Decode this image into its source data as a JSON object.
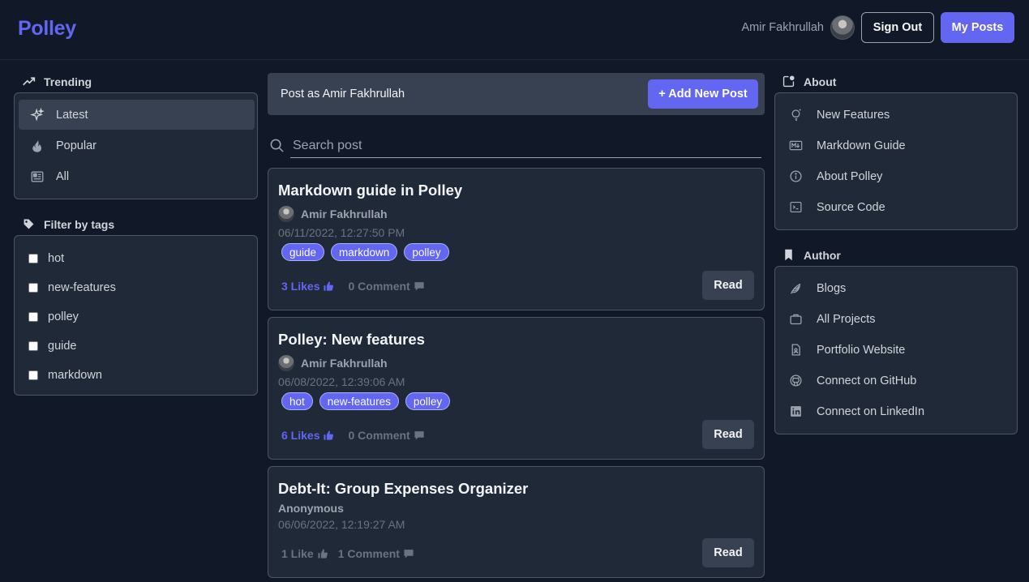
{
  "header": {
    "logo": "Polley",
    "user_name": "Amir Fakhrullah",
    "sign_out": "Sign Out",
    "my_posts": "My Posts"
  },
  "left": {
    "trending_title": "Trending",
    "trending_items": [
      {
        "label": "Latest",
        "icon": "sparkles-icon",
        "active": true
      },
      {
        "label": "Popular",
        "icon": "fire-icon"
      },
      {
        "label": "All",
        "icon": "newspaper-icon"
      }
    ],
    "filter_title": "Filter by tags",
    "tags": [
      "hot",
      "new-features",
      "polley",
      "guide",
      "markdown"
    ]
  },
  "main": {
    "post_as": "Post as Amir Fakhrullah",
    "add_post": "+ Add New Post",
    "search_placeholder": "Search post",
    "read_label": "Read",
    "posts": [
      {
        "title": "Markdown guide in Polley",
        "author": "Amir Fakhrullah",
        "date": "06/11/2022, 12:27:50 PM",
        "tags": [
          "guide",
          "markdown",
          "polley"
        ],
        "likes": "3 Likes",
        "comments": "0 Comment"
      },
      {
        "title": "Polley: New features",
        "author": "Amir Fakhrullah",
        "date": "06/08/2022, 12:39:06 AM",
        "tags": [
          "hot",
          "new-features",
          "polley"
        ],
        "likes": "6 Likes",
        "comments": "0 Comment"
      },
      {
        "title": "Debt-It: Group Expenses Organizer",
        "author": "Anonymous",
        "date": "06/06/2022, 12:19:27 AM",
        "tags": [],
        "likes": "1 Like",
        "comments": "1 Comment"
      }
    ]
  },
  "right": {
    "about_title": "About",
    "about_links": [
      {
        "label": "New Features",
        "icon": "lightbulb-icon"
      },
      {
        "label": "Markdown Guide",
        "icon": "markdown-icon"
      },
      {
        "label": "About Polley",
        "icon": "info-icon"
      },
      {
        "label": "Source Code",
        "icon": "terminal-icon"
      }
    ],
    "author_title": "Author",
    "author_links": [
      {
        "label": "Blogs",
        "icon": "feather-icon"
      },
      {
        "label": "All Projects",
        "icon": "briefcase-icon"
      },
      {
        "label": "Portfolio Website",
        "icon": "document-icon"
      },
      {
        "label": "Connect on GitHub",
        "icon": "github-icon"
      },
      {
        "label": "Connect on LinkedIn",
        "icon": "linkedin-icon"
      }
    ]
  },
  "colors": {
    "background": "#111827",
    "panel": "#1f2937",
    "accent": "#6366f1"
  }
}
